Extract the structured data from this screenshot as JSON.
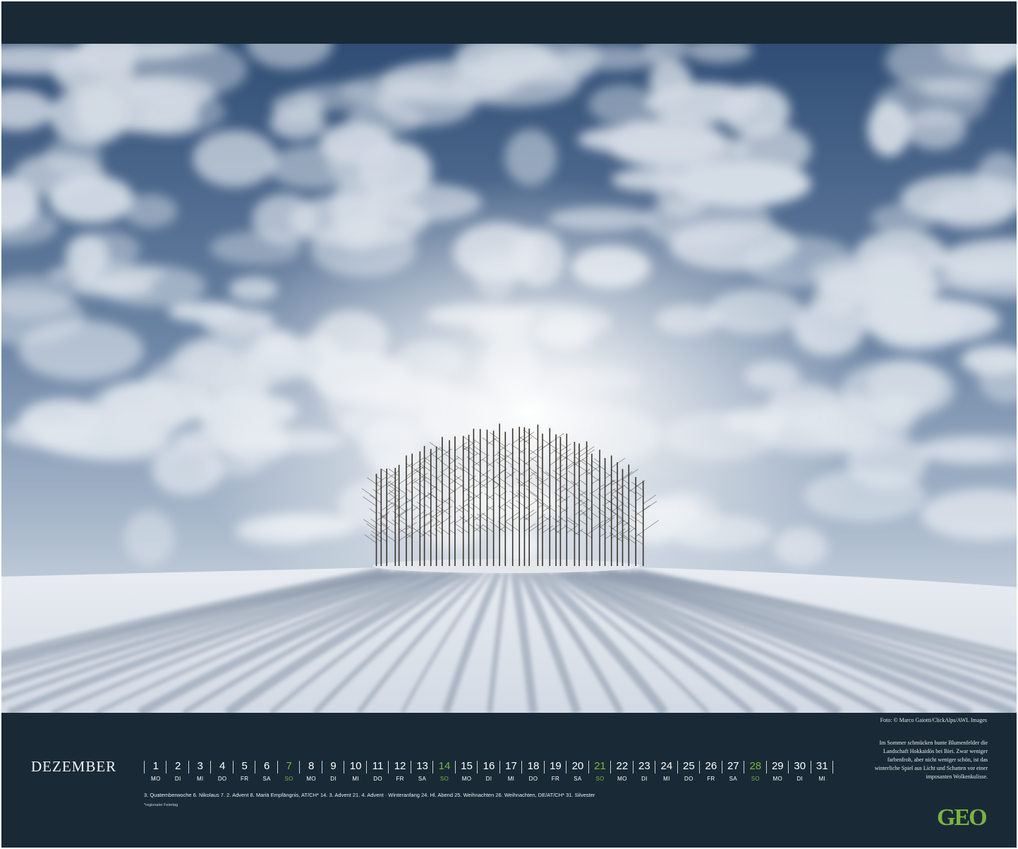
{
  "photo": {
    "description_icon": "winter-tree-grove-photo",
    "colors": {
      "sky_dark": "#2d4c76",
      "cloud": "#e8edf2",
      "snow": "#dfe5ec",
      "shadow": "#8a97aa",
      "trees": "#3a3328"
    }
  },
  "credit": "Foto: © Marco Gaiotti/ClickAlps/AWL Images",
  "caption": "Im Sommer schmücken bunte Blumenfelder die Landschaft Hokkaidōs bei Biei. Zwar weniger farbenfroh, aber nicht weniger schön, ist das winterliche Spiel aus Licht und Schatten vor einer imposanten Wolkenkulisse.",
  "month": "DEZEMBER",
  "days": [
    {
      "n": "1",
      "wd": "MO"
    },
    {
      "n": "2",
      "wd": "DI"
    },
    {
      "n": "3",
      "wd": "MI"
    },
    {
      "n": "4",
      "wd": "DO"
    },
    {
      "n": "5",
      "wd": "FR"
    },
    {
      "n": "6",
      "wd": "SA"
    },
    {
      "n": "7",
      "wd": "SO",
      "sun": true
    },
    {
      "n": "8",
      "wd": "MO"
    },
    {
      "n": "9",
      "wd": "DI"
    },
    {
      "n": "10",
      "wd": "MI"
    },
    {
      "n": "11",
      "wd": "DO"
    },
    {
      "n": "12",
      "wd": "FR"
    },
    {
      "n": "13",
      "wd": "SA"
    },
    {
      "n": "14",
      "wd": "SO",
      "sun": true
    },
    {
      "n": "15",
      "wd": "MO"
    },
    {
      "n": "16",
      "wd": "DI"
    },
    {
      "n": "17",
      "wd": "MI"
    },
    {
      "n": "18",
      "wd": "DO"
    },
    {
      "n": "19",
      "wd": "FR"
    },
    {
      "n": "20",
      "wd": "SA"
    },
    {
      "n": "21",
      "wd": "SO",
      "sun": true
    },
    {
      "n": "22",
      "wd": "MO"
    },
    {
      "n": "23",
      "wd": "DI"
    },
    {
      "n": "24",
      "wd": "MI"
    },
    {
      "n": "25",
      "wd": "DO"
    },
    {
      "n": "26",
      "wd": "FR"
    },
    {
      "n": "27",
      "wd": "SA"
    },
    {
      "n": "28",
      "wd": "SO",
      "sun": true
    },
    {
      "n": "29",
      "wd": "MO"
    },
    {
      "n": "30",
      "wd": "DI"
    },
    {
      "n": "31",
      "wd": "MI"
    }
  ],
  "holidays": "3. Quatemberwoche   6. Nikolaus   7. 2. Advent   8. Mariä Empfängnis, AT/CH*   14. 3. Advent   21. 4. Advent · Winteranfang   24. Hl. Abend   25. Weihnachten   26. Weihnachten, DE/AT/CH*   31. Silvester",
  "footnote": "*regionaler Feiertag",
  "logo": "GEO",
  "accent_color": "#7cb342"
}
